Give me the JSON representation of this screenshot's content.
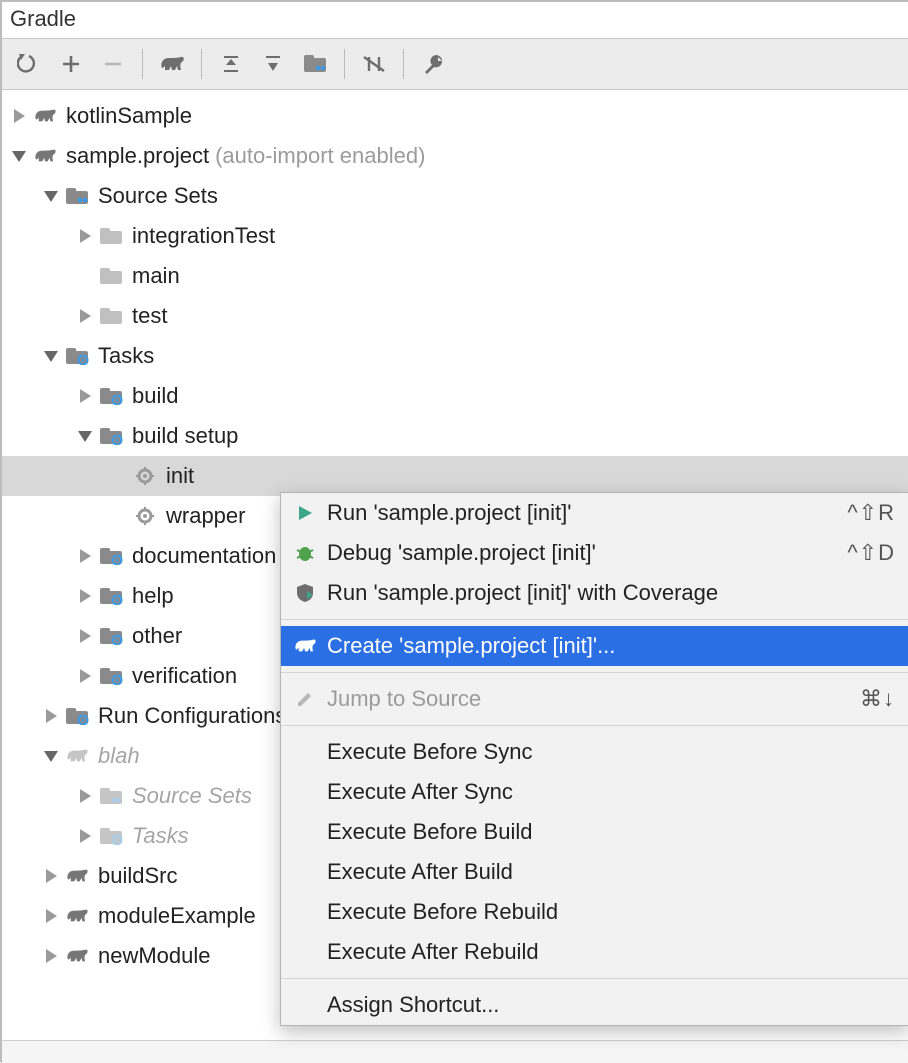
{
  "panel": {
    "title": "Gradle"
  },
  "toolbar": {
    "icons": [
      "refresh",
      "add",
      "remove",
      "elephant",
      "expand-all",
      "collapse-all",
      "folder-module",
      "toggle-offline",
      "wrench"
    ]
  },
  "tree": {
    "nodes": [
      {
        "id": "kotlinSample",
        "label": "kotlinSample",
        "icon": "elephant",
        "indent": 0,
        "expanded": false
      },
      {
        "id": "sample.project",
        "label": "sample.project",
        "hint": "(auto-import enabled)",
        "icon": "elephant",
        "indent": 0,
        "expanded": true
      },
      {
        "id": "sourceSets",
        "label": "Source Sets",
        "icon": "folder-module",
        "indent": 1,
        "expanded": true
      },
      {
        "id": "integrationTest",
        "label": "integrationTest",
        "icon": "folder",
        "indent": 2,
        "expanded": false
      },
      {
        "id": "main",
        "label": "main",
        "icon": "folder",
        "indent": 2,
        "expanded": null
      },
      {
        "id": "test",
        "label": "test",
        "icon": "folder",
        "indent": 2,
        "expanded": false
      },
      {
        "id": "tasks",
        "label": "Tasks",
        "icon": "folder-gear",
        "indent": 1,
        "expanded": true
      },
      {
        "id": "build",
        "label": "build",
        "icon": "folder-gear",
        "indent": 2,
        "expanded": false
      },
      {
        "id": "buildSetup",
        "label": "build setup",
        "icon": "folder-gear",
        "indent": 2,
        "expanded": true
      },
      {
        "id": "init",
        "label": "init",
        "icon": "gear",
        "indent": 3,
        "expanded": null,
        "selected": true
      },
      {
        "id": "wrapper",
        "label": "wrapper",
        "icon": "gear",
        "indent": 3,
        "expanded": null,
        "clipped": true
      },
      {
        "id": "documentation",
        "label": "documentation",
        "icon": "folder-gear",
        "indent": 2,
        "expanded": false,
        "clipped": true
      },
      {
        "id": "help",
        "label": "help",
        "icon": "folder-gear",
        "indent": 2,
        "expanded": false
      },
      {
        "id": "other",
        "label": "other",
        "icon": "folder-gear",
        "indent": 2,
        "expanded": false
      },
      {
        "id": "verification",
        "label": "verification",
        "icon": "folder-gear",
        "indent": 2,
        "expanded": false,
        "clipped": true
      },
      {
        "id": "runConfig",
        "label": "Run Configurations",
        "icon": "folder-gear",
        "indent": 1,
        "expanded": false,
        "clipped": true
      },
      {
        "id": "blah",
        "label": "blah",
        "icon": "elephant-faded",
        "indent": 1,
        "expanded": true,
        "faded": true
      },
      {
        "id": "blahSourceSets",
        "label": "Source Sets",
        "icon": "folder-module-faded",
        "indent": 2,
        "expanded": false,
        "faded": true,
        "clipped": true
      },
      {
        "id": "blahTasks",
        "label": "Tasks",
        "icon": "folder-gear-faded",
        "indent": 2,
        "expanded": false,
        "faded": true
      },
      {
        "id": "buildSrc",
        "label": "buildSrc",
        "icon": "elephant",
        "indent": 1,
        "expanded": false
      },
      {
        "id": "moduleExample",
        "label": "moduleExample",
        "icon": "elephant",
        "indent": 1,
        "expanded": false,
        "clipped": true
      },
      {
        "id": "newModule",
        "label": "newModule",
        "icon": "elephant",
        "indent": 1,
        "expanded": false
      }
    ]
  },
  "context_menu": {
    "items": [
      {
        "icon": "run",
        "label": "Run 'sample.project [init]'",
        "shortcut": "^⇧R"
      },
      {
        "icon": "debug",
        "label": "Debug 'sample.project [init]'",
        "shortcut": "^⇧D"
      },
      {
        "icon": "coverage",
        "label": "Run 'sample.project [init]' with Coverage",
        "shortcut": ""
      },
      {
        "sep": true
      },
      {
        "icon": "elephant-white",
        "label": "Create 'sample.project [init]'...",
        "selected": true
      },
      {
        "sep": true
      },
      {
        "icon": "edit",
        "label": "Jump to Source",
        "shortcut": "⌘↓",
        "disabled": true
      },
      {
        "sep": true
      },
      {
        "label": "Execute Before Sync"
      },
      {
        "label": "Execute After Sync"
      },
      {
        "label": "Execute Before Build"
      },
      {
        "label": "Execute After Build"
      },
      {
        "label": "Execute Before Rebuild"
      },
      {
        "label": "Execute After Rebuild"
      },
      {
        "sep": true
      },
      {
        "label": "Assign Shortcut..."
      }
    ]
  }
}
